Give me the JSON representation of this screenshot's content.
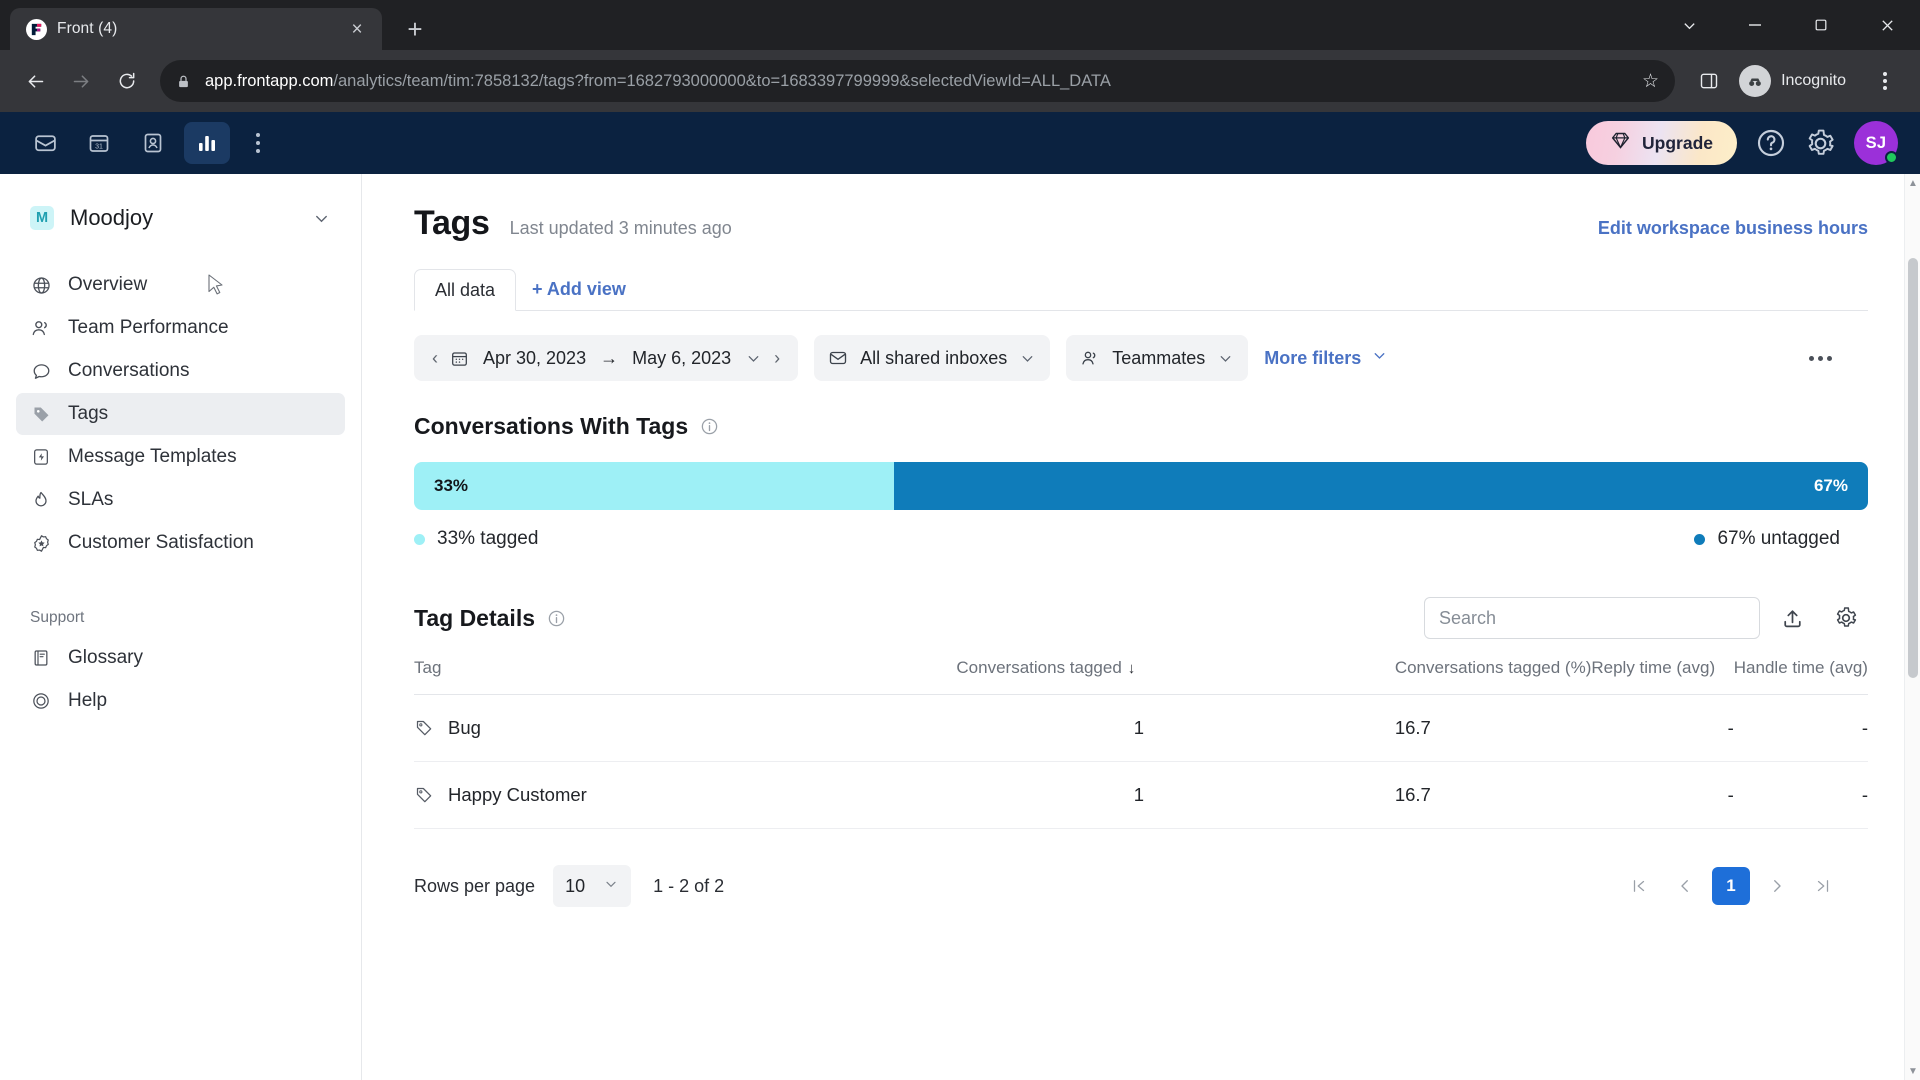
{
  "browser": {
    "tab": {
      "title": "Front (4)",
      "favicon": "front-logo-icon",
      "close": "×"
    },
    "new_tab": "+",
    "window": {
      "minimize": "–",
      "maximize": "▢",
      "close": "✕",
      "chevron": "⌄"
    },
    "nav": {
      "back": "←",
      "forward": "→",
      "reload": "⟳"
    },
    "url": {
      "host": "app.frontapp.com",
      "path": "/analytics/team/tim:7858132/tags?from=1682793000000&to=1683397799999&selectedViewId=ALL_DATA"
    },
    "profile_label": "Incognito",
    "bookmark_star": "☆"
  },
  "appbar": {
    "nav_items": [
      {
        "name": "inbox-icon",
        "active": false
      },
      {
        "name": "calendar-icon",
        "active": false,
        "day": "31"
      },
      {
        "name": "contacts-icon",
        "active": false
      },
      {
        "name": "analytics-icon",
        "active": true
      }
    ],
    "upgrade_label": "Upgrade",
    "avatar_initials": "SJ"
  },
  "sidebar": {
    "workspace": "Moodjoy",
    "workspace_badge": "M",
    "items": [
      {
        "label": "Overview",
        "icon": "globe-icon",
        "active": false
      },
      {
        "label": "Team Performance",
        "icon": "people-icon",
        "active": false
      },
      {
        "label": "Conversations",
        "icon": "chat-bubble-icon",
        "active": false
      },
      {
        "label": "Tags",
        "icon": "tag-icon",
        "active": true
      },
      {
        "label": "Message Templates",
        "icon": "template-icon",
        "active": false
      },
      {
        "label": "SLAs",
        "icon": "flame-icon",
        "active": false
      },
      {
        "label": "Customer Satisfaction",
        "icon": "star-badge-icon",
        "active": false
      }
    ],
    "support_section": "Support",
    "support_items": [
      {
        "label": "Glossary",
        "icon": "book-icon"
      },
      {
        "label": "Help",
        "icon": "help-circle-icon"
      }
    ]
  },
  "page": {
    "title": "Tags",
    "last_updated": "Last updated 3 minutes ago",
    "edit_hours_link": "Edit workspace business hours"
  },
  "views": {
    "tabs": [
      {
        "label": "All data",
        "active": true
      }
    ],
    "add_view": "+ Add view"
  },
  "filters": {
    "date_from": "Apr 30, 2023",
    "date_arrow": "→",
    "date_to": "May 6, 2023",
    "prev": "‹",
    "next": "›",
    "inboxes": "All shared inboxes",
    "teammates": "Teammates",
    "more_filters": "More filters"
  },
  "conversations_with_tags": {
    "title": "Conversations With Tags",
    "tagged_pct_label": "33%",
    "untagged_pct_label": "67%",
    "legend_tagged": "33% tagged",
    "legend_untagged": "67% untagged",
    "color_tagged": "#9ef0f6",
    "color_untagged": "#0f7cba"
  },
  "chart_data": {
    "type": "bar",
    "title": "Conversations With Tags",
    "categories": [
      "tagged",
      "untagged"
    ],
    "values": [
      33,
      67
    ],
    "value_labels": [
      "33%",
      "67%"
    ],
    "legend": [
      "33% tagged",
      "67% untagged"
    ],
    "colors": [
      "#9ef0f6",
      "#0f7cba"
    ],
    "orientation": "horizontal-stacked",
    "xlabel": "",
    "ylabel": "",
    "ylim": [
      0,
      100
    ],
    "grid": false,
    "legend_position": "below"
  },
  "tag_details": {
    "title": "Tag Details",
    "search_placeholder": "Search",
    "search_value": "",
    "columns": [
      "Tag",
      "Conversations tagged",
      "Conversations tagged (%)",
      "Reply time (avg)",
      "Handle time (avg)"
    ],
    "sorted_column": "Conversations tagged",
    "sort_direction": "↓",
    "rows": [
      {
        "tag": "Bug",
        "conversations_tagged": "1",
        "pct": "16.7",
        "pct_value": 16.7,
        "reply_time": "-",
        "handle_time": "-"
      },
      {
        "tag": "Happy Customer",
        "conversations_tagged": "1",
        "pct": "16.7",
        "pct_value": 16.7,
        "reply_time": "-",
        "handle_time": "-"
      }
    ],
    "bar_color": "#1fbaf0"
  },
  "pagination": {
    "rows_per_page_label": "Rows per page",
    "rows_per_page_value": "10",
    "range": "1 - 2 of 2",
    "first": "|‹",
    "prev": "‹",
    "current_page": "1",
    "next": "›",
    "last": "›|"
  }
}
